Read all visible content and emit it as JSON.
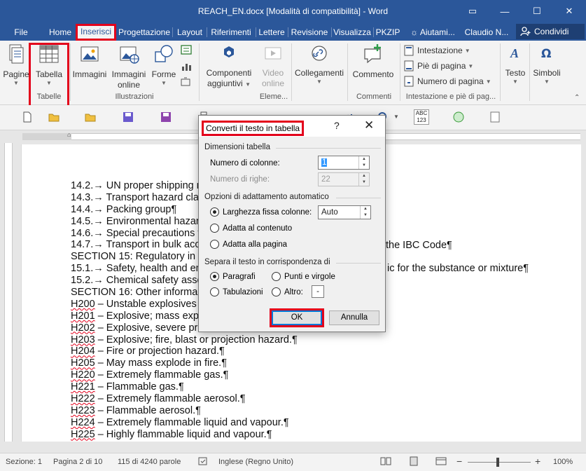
{
  "window": {
    "title": "REACH_EN.docx [Modalità di compatibilità] - Word",
    "controls": {
      "restore": "▭",
      "minimize": "—",
      "maximize": "☐",
      "close": "✕"
    }
  },
  "tabs": [
    {
      "label": "File"
    },
    {
      "label": "Home"
    },
    {
      "label": "Inserisci",
      "active": true
    },
    {
      "label": "Progettazione"
    },
    {
      "label": "Layout"
    },
    {
      "label": "Riferimenti"
    },
    {
      "label": "Lettere"
    },
    {
      "label": "Revisione"
    },
    {
      "label": "Visualizza"
    },
    {
      "label": "PKZIP"
    },
    {
      "label": "Aiutami..."
    },
    {
      "label": "Claudio N..."
    }
  ],
  "share": {
    "label": "Condividi",
    "icon": "person-add-icon"
  },
  "ribbon": {
    "pagine": "Pagine",
    "tabella": "Tabella",
    "tabelle_group": "Tabelle",
    "immagini": "Immagini",
    "immagini_online_1": "Immagini",
    "immagini_online_2": "online",
    "forme": "Forme",
    "illustrazioni_group": "Illustrazioni",
    "componenti_1": "Componenti",
    "componenti_2": "aggiuntivi",
    "video_1": "Video",
    "video_2": "online",
    "elementi_group": "Eleme...",
    "collegamenti": "Collegamenti",
    "commento": "Commento",
    "commenti_group": "Commenti",
    "intestazione": "Intestazione",
    "pie_di_pagina": "Piè di pagina",
    "numero_di_pagina": "Numero di pagina",
    "intestazione_group": "Intestazione e piè di pag...",
    "testo": "Testo",
    "simboli": "Simboli"
  },
  "qat": {
    "abc_label": "ABC",
    "abc_num": "123"
  },
  "document": {
    "lines": [
      {
        "code": "",
        "text": "14.2.→ UN proper shipping n"
      },
      {
        "code": "",
        "text": "14.3.→ Transport hazard cla"
      },
      {
        "code": "",
        "text": "14.4.→ Packing group¶"
      },
      {
        "code": "",
        "text": "14.5.→ Environmental hazar"
      },
      {
        "code": "",
        "text": "14.6.→ Special precautions f"
      },
      {
        "code": "",
        "text": "14.7.→ Transport in bulk acc"
      },
      {
        "code": "",
        "text": "SECTION 15: Regulatory in"
      },
      {
        "code": "",
        "text": "15.1.→ Safety, health and en"
      },
      {
        "code": "",
        "text": "15.2.→ Chemical safety asse"
      },
      {
        "code": "",
        "text": "SECTION 16: Other informa"
      },
      {
        "code": "H200",
        "text": " – Unstable explosives"
      },
      {
        "code": "H201",
        "text": " – Explosive; mass exp"
      },
      {
        "code": "H202",
        "text": " – Explosive, severe pr"
      },
      {
        "code": "H203",
        "text": " – Explosive; fire, blast or projection hazard.¶"
      },
      {
        "code": "H204",
        "text": " – Fire or projection hazard.¶"
      },
      {
        "code": "H205",
        "text": " – May mass explode in fire.¶"
      },
      {
        "code": "H220",
        "text": " – Extremely flammable gas.¶"
      },
      {
        "code": "H221",
        "text": " – Flammable gas.¶"
      },
      {
        "code": "H222",
        "text": " – Extremely flammable aerosol.¶"
      },
      {
        "code": "H223",
        "text": " – Flammable aerosol.¶"
      },
      {
        "code": "H224",
        "text": " – Extremely flammable liquid and vapour.¶"
      },
      {
        "code": "H225",
        "text": " – Highly flammable liquid and vapour.¶"
      }
    ],
    "right_fragments": [
      {
        "line": 5,
        "text": "the IBC Code¶"
      },
      {
        "line": 7,
        "text": "ic for the substance or mixture¶"
      }
    ]
  },
  "dialog": {
    "title": "Converti il testo in tabella",
    "help": "?",
    "close": "✕",
    "section_dimensions": "Dimensioni tabella",
    "num_columns_label": "Numero di colonne:",
    "num_columns_value": "1",
    "num_rows_label": "Numero di righe:",
    "num_rows_value": "22",
    "section_autofit": "Opzioni di adattamento automatico",
    "fixed_width_label": "Larghezza fissa colonne:",
    "fixed_width_value": "Auto",
    "fit_content_label": "Adatta al contenuto",
    "fit_window_label": "Adatta alla pagina",
    "section_separator": "Separa il testo in corrispondenza di",
    "sep_paragraphs": "Paragrafi",
    "sep_semicolons": "Punti e virgole",
    "sep_tabs": "Tabulazioni",
    "sep_other": "Altro:",
    "sep_other_value": "-",
    "ok": "OK",
    "cancel": "Annulla"
  },
  "status": {
    "section": "Sezione: 1",
    "page": "Pagina 2 di 10",
    "words": "115 di 4240 parole",
    "language": "Inglese (Regno Unito)",
    "zoom": "100%",
    "zoom_minus": "−",
    "zoom_plus": "+"
  }
}
